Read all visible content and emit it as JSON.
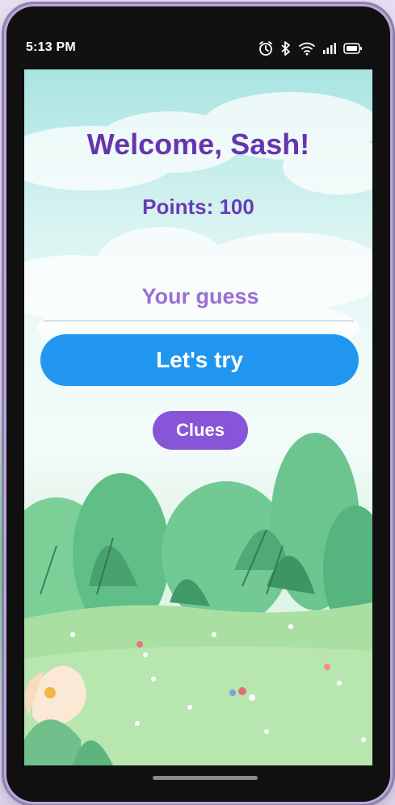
{
  "status_bar": {
    "time": "5:13 PM",
    "icons": [
      "alarm-icon",
      "bluetooth-icon",
      "wifi-icon",
      "signal-icon",
      "battery-icon"
    ]
  },
  "game": {
    "title": "Welcome, Sash!",
    "points": "Points: 100",
    "guess_placeholder": "Your guess",
    "guess_value": "",
    "try_label": "Let's try",
    "clues_label": "Clues"
  },
  "colors": {
    "title": "#6535b0",
    "primary_button": "#2196f0",
    "secondary_button": "#8755d8",
    "placeholder": "#9a6fd4"
  }
}
